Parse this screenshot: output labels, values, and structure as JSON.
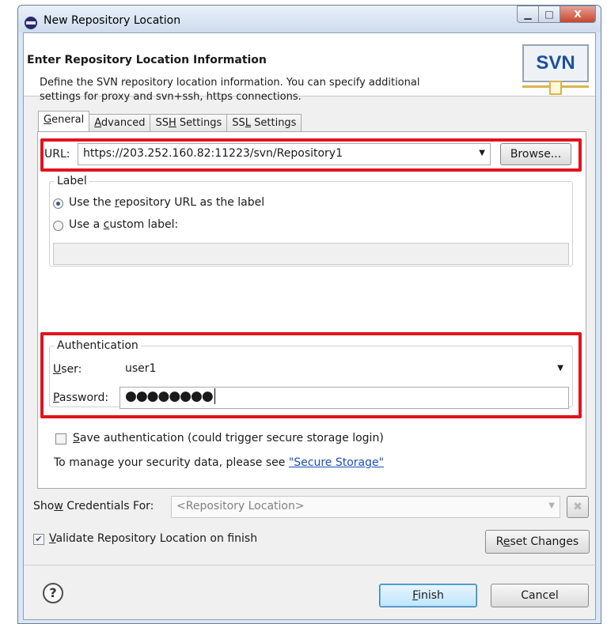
{
  "window": {
    "title": "New Repository Location",
    "minimize": "▁",
    "maximize": "□",
    "close": "X"
  },
  "header": {
    "title": "Enter Repository Location Information",
    "description": "Define the SVN repository location information. You can specify additional settings for proxy and svn+ssh, https connections.",
    "logo_text": "SVN"
  },
  "tabs": [
    {
      "label_pre": "",
      "mnemonic": "G",
      "label_post": "eneral",
      "active": true
    },
    {
      "label_pre": "",
      "mnemonic": "A",
      "label_post": "dvanced",
      "active": false
    },
    {
      "label_pre": "SS",
      "mnemonic": "H",
      "label_post": " Settings",
      "active": false
    },
    {
      "label_pre": "SS",
      "mnemonic": "L",
      "label_post": " Settings",
      "active": false
    }
  ],
  "general": {
    "url_label": "URL:",
    "url_value": "https://203.252.160.82:11223/svn/Repository1",
    "browse_label": "Browse...",
    "label_group": "Label",
    "radio_repo_pre": "Use the ",
    "radio_repo_mn": "r",
    "radio_repo_post": "epository URL as the label",
    "radio_custom_pre": "Use a ",
    "radio_custom_mn": "c",
    "radio_custom_post": "ustom label:",
    "custom_label_value": "",
    "auth_group": "Authentication",
    "user_mn": "U",
    "user_post": "ser:",
    "user_value": "user1",
    "password_mn": "P",
    "password_post": "assword:",
    "password_value": "●●●●●●●●",
    "save_auth_mn": "S",
    "save_auth_post": "ave authentication (could trigger secure storage login)",
    "manage_text": "To manage your security data, please see ",
    "secure_storage_link": "\"Secure Storage\""
  },
  "footer": {
    "show_credentials_pre": "Sho",
    "show_credentials_mn": "w",
    "show_credentials_post": " Credentials For:",
    "show_credentials_value": "<Repository Location>",
    "validate_mn": "V",
    "validate_post": "alidate Repository Location on finish",
    "validate_checked": true,
    "reset_pre": "R",
    "reset_mn": "e",
    "reset_post": "set Changes",
    "help_symbol": "?",
    "finish_mn": "F",
    "finish_post": "inish",
    "cancel_label": "Cancel"
  },
  "colors": {
    "highlight": "#e0141e",
    "link": "#1a4fb5",
    "logo_text": "#1d4f9c"
  }
}
